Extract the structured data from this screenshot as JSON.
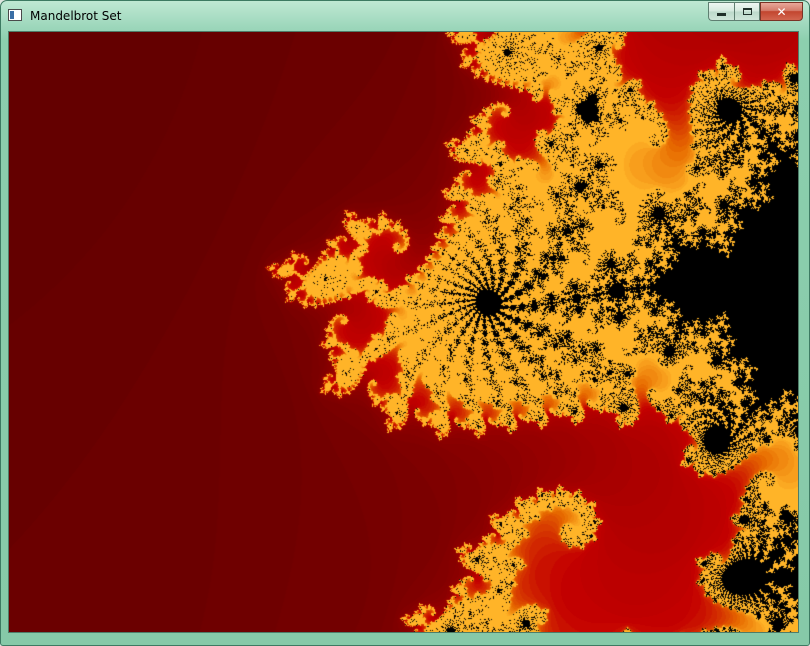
{
  "window": {
    "title": "Mandelbrot Set",
    "icon": "app-window-icon",
    "caption_buttons": {
      "minimize_icon": "minimize-icon",
      "maximize_icon": "maximize-icon",
      "close_icon": "close-icon",
      "close_glyph": "✕"
    },
    "frame_color": "#8ccfae",
    "close_color": "#c2452f"
  },
  "fractal": {
    "type": "mandelbrot",
    "set_color": "#000000",
    "outer_color": "#1a0000",
    "edge_color": "#ff2a10",
    "highlight_color": "#ffb020"
  }
}
